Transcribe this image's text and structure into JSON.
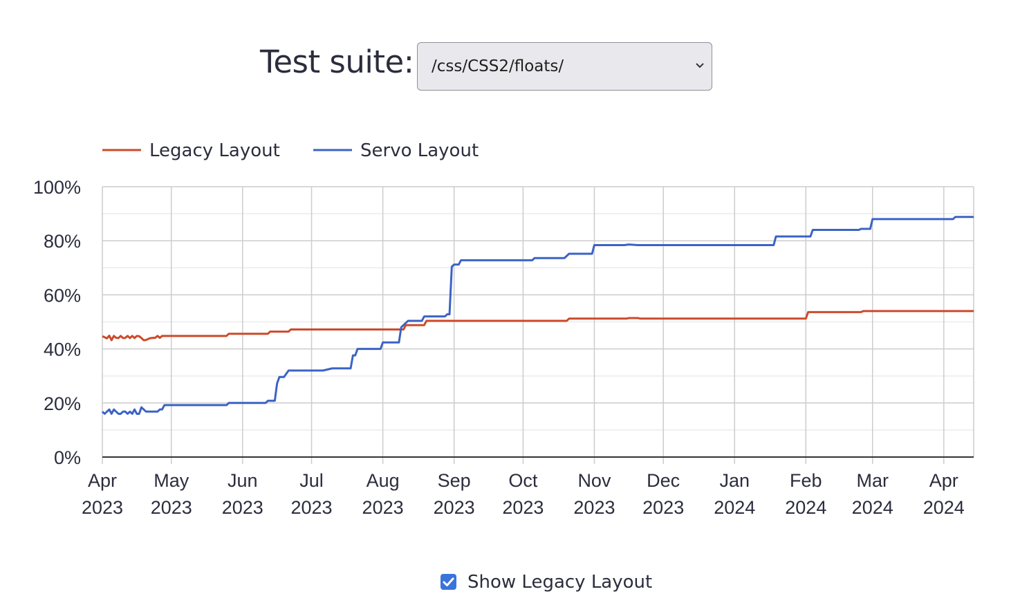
{
  "header": {
    "suite_label": "Test suite:",
    "suite_value": "/css/CSS2/floats/"
  },
  "toggle": {
    "label": "Show Legacy Layout",
    "checked": true
  },
  "chart_data": {
    "type": "line",
    "xlim": [
      "2023-04-01",
      "2024-04-14"
    ],
    "ylim": [
      0,
      100
    ],
    "yticks": [
      0,
      20,
      40,
      60,
      80,
      100
    ],
    "ytick_labels": [
      "0%",
      "20%",
      "40%",
      "60%",
      "80%",
      "100%"
    ],
    "xticks": [
      "2023-04-01",
      "2023-05-01",
      "2023-06-01",
      "2023-07-01",
      "2023-08-01",
      "2023-09-01",
      "2023-10-01",
      "2023-11-01",
      "2023-12-01",
      "2024-01-01",
      "2024-02-01",
      "2024-03-01",
      "2024-04-01"
    ],
    "xtick_labels": [
      [
        "Apr",
        "2023"
      ],
      [
        "May",
        "2023"
      ],
      [
        "Jun",
        "2023"
      ],
      [
        "Jul",
        "2023"
      ],
      [
        "Aug",
        "2023"
      ],
      [
        "Sep",
        "2023"
      ],
      [
        "Oct",
        "2023"
      ],
      [
        "Nov",
        "2023"
      ],
      [
        "Dec",
        "2023"
      ],
      [
        "Jan",
        "2024"
      ],
      [
        "Feb",
        "2024"
      ],
      [
        "Mar",
        "2024"
      ],
      [
        "Apr",
        "2024"
      ]
    ],
    "grid": true,
    "legend_position": "top-left",
    "series": [
      {
        "name": "Legacy Layout",
        "color": "#cc4a2a",
        "points": [
          [
            "2023-04-01",
            44.7
          ],
          [
            "2023-04-02",
            44.3
          ],
          [
            "2023-04-03",
            43.9
          ],
          [
            "2023-04-04",
            44.9
          ],
          [
            "2023-04-05",
            43.2
          ],
          [
            "2023-04-06",
            44.8
          ],
          [
            "2023-04-07",
            44.1
          ],
          [
            "2023-04-08",
            44.0
          ],
          [
            "2023-04-09",
            44.8
          ],
          [
            "2023-04-10",
            44.0
          ],
          [
            "2023-04-11",
            44.1
          ],
          [
            "2023-04-12",
            44.8
          ],
          [
            "2023-04-13",
            44.0
          ],
          [
            "2023-04-14",
            44.8
          ],
          [
            "2023-04-15",
            44.0
          ],
          [
            "2023-04-16",
            44.8
          ],
          [
            "2023-04-17",
            44.7
          ],
          [
            "2023-04-18",
            44.0
          ],
          [
            "2023-04-19",
            43.2
          ],
          [
            "2023-04-20",
            43.3
          ],
          [
            "2023-04-21",
            43.7
          ],
          [
            "2023-04-22",
            44.0
          ],
          [
            "2023-04-23",
            44.1
          ],
          [
            "2023-04-24",
            44.1
          ],
          [
            "2023-04-25",
            44.8
          ],
          [
            "2023-04-26",
            44.1
          ],
          [
            "2023-04-27",
            44.8
          ],
          [
            "2023-05-25",
            44.8
          ],
          [
            "2023-05-26",
            45.6
          ],
          [
            "2023-06-12",
            45.6
          ],
          [
            "2023-06-13",
            46.4
          ],
          [
            "2023-06-21",
            46.4
          ],
          [
            "2023-06-22",
            47.2
          ],
          [
            "2023-08-10",
            47.2
          ],
          [
            "2023-08-11",
            48.8
          ],
          [
            "2023-08-19",
            48.8
          ],
          [
            "2023-08-20",
            50.4
          ],
          [
            "2023-10-20",
            50.4
          ],
          [
            "2023-10-21",
            51.2
          ],
          [
            "2023-11-15",
            51.2
          ],
          [
            "2023-11-16",
            51.4
          ],
          [
            "2023-11-20",
            51.4
          ],
          [
            "2023-11-21",
            51.2
          ],
          [
            "2024-02-01",
            51.2
          ],
          [
            "2024-02-02",
            53.6
          ],
          [
            "2024-02-25",
            53.6
          ],
          [
            "2024-02-26",
            54.0
          ],
          [
            "2024-04-14",
            54.0
          ]
        ]
      },
      {
        "name": "Servo Layout",
        "color": "#3b63c5",
        "points": [
          [
            "2023-04-01",
            16.8
          ],
          [
            "2023-04-02",
            16.0
          ],
          [
            "2023-04-03",
            16.8
          ],
          [
            "2023-04-04",
            17.6
          ],
          [
            "2023-04-05",
            16.0
          ],
          [
            "2023-04-06",
            17.6
          ],
          [
            "2023-04-07",
            16.8
          ],
          [
            "2023-04-08",
            16.0
          ],
          [
            "2023-04-09",
            16.0
          ],
          [
            "2023-04-10",
            16.8
          ],
          [
            "2023-04-11",
            16.8
          ],
          [
            "2023-04-12",
            16.0
          ],
          [
            "2023-04-13",
            16.8
          ],
          [
            "2023-04-14",
            16.0
          ],
          [
            "2023-04-15",
            17.6
          ],
          [
            "2023-04-16",
            16.0
          ],
          [
            "2023-04-17",
            16.0
          ],
          [
            "2023-04-18",
            18.4
          ],
          [
            "2023-04-19",
            17.6
          ],
          [
            "2023-04-20",
            16.8
          ],
          [
            "2023-04-25",
            16.8
          ],
          [
            "2023-04-26",
            17.6
          ],
          [
            "2023-04-27",
            17.6
          ],
          [
            "2023-04-28",
            19.2
          ],
          [
            "2023-05-25",
            19.2
          ],
          [
            "2023-05-26",
            20.0
          ],
          [
            "2023-06-11",
            20.0
          ],
          [
            "2023-06-12",
            20.8
          ],
          [
            "2023-06-15",
            20.8
          ],
          [
            "2023-06-16",
            27.2
          ],
          [
            "2023-06-17",
            29.6
          ],
          [
            "2023-06-19",
            29.6
          ],
          [
            "2023-06-21",
            32.0
          ],
          [
            "2023-07-06",
            32.0
          ],
          [
            "2023-07-10",
            32.8
          ],
          [
            "2023-07-18",
            32.8
          ],
          [
            "2023-07-19",
            37.6
          ],
          [
            "2023-07-20",
            37.6
          ],
          [
            "2023-07-21",
            40.0
          ],
          [
            "2023-07-31",
            40.0
          ],
          [
            "2023-08-01",
            42.4
          ],
          [
            "2023-08-08",
            42.4
          ],
          [
            "2023-08-09",
            48.0
          ],
          [
            "2023-08-10",
            48.8
          ],
          [
            "2023-08-12",
            50.4
          ],
          [
            "2023-08-18",
            50.4
          ],
          [
            "2023-08-19",
            52.0
          ],
          [
            "2023-08-28",
            52.0
          ],
          [
            "2023-08-29",
            52.8
          ],
          [
            "2023-08-30",
            52.8
          ],
          [
            "2023-08-31",
            70.4
          ],
          [
            "2023-09-01",
            71.2
          ],
          [
            "2023-09-03",
            71.2
          ],
          [
            "2023-09-04",
            72.8
          ],
          [
            "2023-10-05",
            72.8
          ],
          [
            "2023-10-06",
            73.6
          ],
          [
            "2023-10-19",
            73.6
          ],
          [
            "2023-10-21",
            75.2
          ],
          [
            "2023-10-31",
            75.2
          ],
          [
            "2023-11-01",
            78.4
          ],
          [
            "2023-11-14",
            78.4
          ],
          [
            "2023-11-16",
            78.6
          ],
          [
            "2023-11-20",
            78.4
          ],
          [
            "2024-01-18",
            78.4
          ],
          [
            "2024-01-19",
            81.6
          ],
          [
            "2024-02-03",
            81.6
          ],
          [
            "2024-02-04",
            84.0
          ],
          [
            "2024-02-24",
            84.0
          ],
          [
            "2024-02-25",
            84.4
          ],
          [
            "2024-02-29",
            84.4
          ],
          [
            "2024-03-01",
            88.0
          ],
          [
            "2024-04-05",
            88.0
          ],
          [
            "2024-04-06",
            88.8
          ],
          [
            "2024-04-14",
            88.8
          ]
        ]
      }
    ]
  }
}
